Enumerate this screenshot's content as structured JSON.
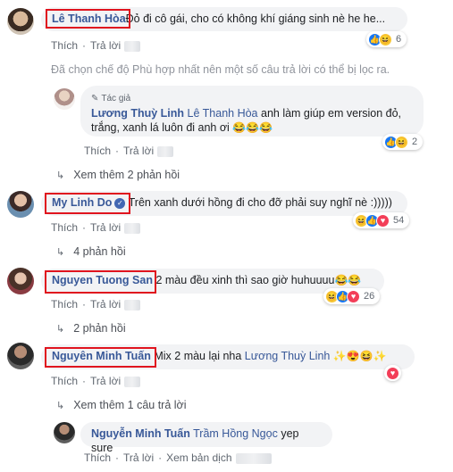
{
  "actions": {
    "like": "Thích",
    "reply": "Trả lời",
    "translate": "Xem bản dịch"
  },
  "filter_note": "Đã chọn chế độ Phù hợp nhất nên một số câu trả lời có thể bị lọc ra.",
  "comments": [
    {
      "name": "Lê Thanh Hòa",
      "text": "Đỏ đi cô gái, cho có không khí giáng sinh nè he he...",
      "reaction_count": "6",
      "reaction_icons": [
        "like-icon",
        "haha-icon"
      ]
    },
    {
      "author_tag": "Tác giả",
      "name": "Lương Thuỳ Linh",
      "mention": "Lê Thanh Hòa",
      "text": " anh làm giúp em version đỏ, trắng, xanh lá luôn đi anh ơi",
      "emoji": "😂😂😂",
      "reaction_count": "2",
      "reaction_icons": [
        "like-icon",
        "haha-icon"
      ],
      "more_replies": "Xem thêm 2 phản hồi"
    },
    {
      "name": "My Linh Do",
      "verified": true,
      "text": "Trên xanh dưới hồng đi cho đỡ phải suy nghĩ nè :)))))",
      "reaction_count": "54",
      "reaction_icons": [
        "haha-icon",
        "like-icon",
        "love-icon"
      ],
      "more_replies": "4 phản hồi"
    },
    {
      "name": "Nguyen Tuong San",
      "text": "2 màu đều xinh thì sao giờ huhuuuu",
      "emoji": "😂😂",
      "reaction_count": "26",
      "reaction_icons": [
        "haha-icon",
        "like-icon",
        "love-icon"
      ],
      "more_replies": "2 phản hồi"
    },
    {
      "name": "Nguyên Minh Tuấn",
      "text": "Mix 2 màu lại nha ",
      "mention": "Lương Thuỳ Linh",
      "emoji": "✨😍😆✨",
      "reaction_icons": [
        "love-icon"
      ],
      "more_replies": "Xem thêm 1 câu trả lời"
    },
    {
      "name": "Nguyễn Minh Tuấn",
      "mention": "Trầm Hồng Ngọc",
      "text": " yep sure"
    }
  ],
  "colors": {
    "highlight_box": "#e0141e",
    "name": "#385898",
    "bubble": "#f2f3f5",
    "like": "#1877f2",
    "love": "#f33e58",
    "haha": "#f7c533"
  }
}
